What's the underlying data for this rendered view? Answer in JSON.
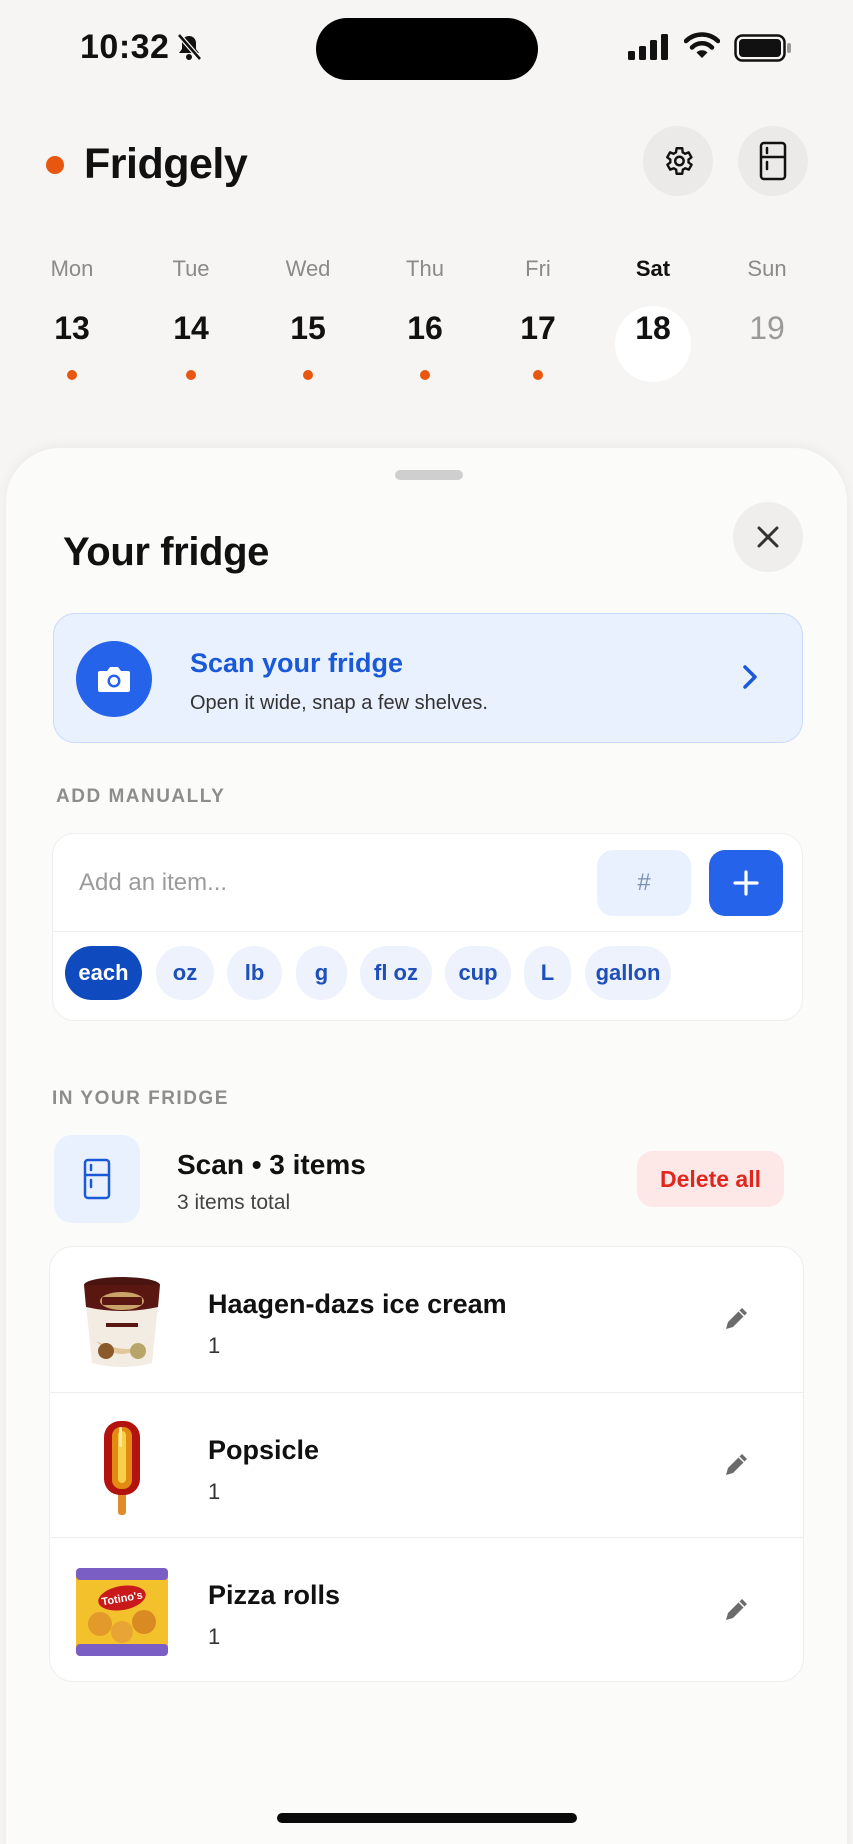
{
  "status_bar": {
    "time": "10:32"
  },
  "app": {
    "name": "Fridgely",
    "accent_color": "#e8560f"
  },
  "header": {
    "settings_icon": "gear-icon",
    "fridge_icon": "fridge-icon"
  },
  "week": {
    "days": [
      {
        "name": "Mon",
        "num": "13",
        "has_dot": true
      },
      {
        "name": "Tue",
        "num": "14",
        "has_dot": true
      },
      {
        "name": "Wed",
        "num": "15",
        "has_dot": true
      },
      {
        "name": "Thu",
        "num": "16",
        "has_dot": true
      },
      {
        "name": "Fri",
        "num": "17",
        "has_dot": true
      },
      {
        "name": "Sat",
        "num": "18",
        "has_dot": true,
        "selected": true
      },
      {
        "name": "Sun",
        "num": "19",
        "has_dot": false,
        "muted": true
      }
    ]
  },
  "sheet": {
    "title": "Your fridge",
    "scan_card": {
      "title": "Scan your fridge",
      "subtitle": "Open it wide, snap a few shelves.",
      "icon": "camera-icon",
      "color": "#2563eb"
    },
    "add_manually": {
      "label": "ADD MANUALLY",
      "placeholder": "Add an item...",
      "quantity_placeholder": "#",
      "units": [
        "each",
        "oz",
        "lb",
        "g",
        "fl oz",
        "cup",
        "L",
        "gallon"
      ],
      "selected_unit": "each"
    },
    "in_fridge": {
      "label": "IN YOUR FRIDGE",
      "group_title": "Scan • 3 items",
      "group_subtitle": "3 items total",
      "delete_all": "Delete all",
      "items": [
        {
          "name": "Haagen-dazs ice cream",
          "qty": "1",
          "thumb": "ice-cream-pint"
        },
        {
          "name": "Popsicle",
          "qty": "1",
          "thumb": "popsicle"
        },
        {
          "name": "Pizza rolls",
          "qty": "1",
          "thumb": "pizza-rolls-bag",
          "thumb_brand": "Totino's"
        }
      ]
    }
  }
}
